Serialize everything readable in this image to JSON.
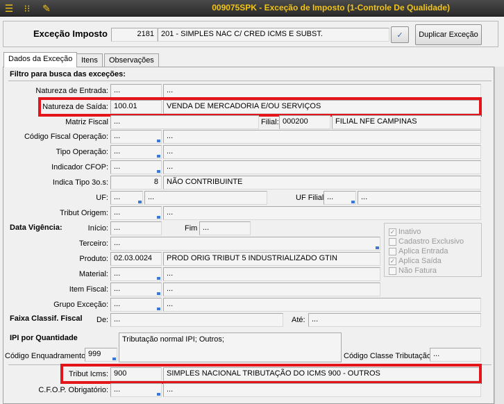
{
  "window": {
    "title": "009075SPK - Exceção de Imposto (1-Controle De Qualidade)",
    "icons": [
      "menu-icon",
      "traffic-light-icon",
      "wrench-icon"
    ]
  },
  "header": {
    "label": "Exceção Imposto",
    "code": "2181",
    "description": "201 - SIMPLES NAC C/ CRED ICMS E SUBST.",
    "confirm_icon": "✓",
    "duplicate_button": "Duplicar Exceção"
  },
  "tabs": [
    {
      "label": "Dados da Exceção",
      "active": true
    },
    {
      "label": "Itens",
      "active": false
    },
    {
      "label": "Observações",
      "active": false
    }
  ],
  "section_filter": "Filtro para busca das exceções:",
  "fields": {
    "natureza_entrada": {
      "label": "Natureza de Entrada:",
      "code": "...",
      "desc": "..."
    },
    "natureza_saida": {
      "label": "Natureza de Saída:",
      "code": "100.01",
      "desc": "VENDA DE MERCADORIA E/OU SERVIÇOS"
    },
    "matriz_fiscal": {
      "label": "Matriz Fiscal",
      "value": "..."
    },
    "filial": {
      "label": "Filial:",
      "code": "000200",
      "desc": "FILIAL NFE CAMPINAS"
    },
    "codigo_fiscal_operacao": {
      "label": "Código Fiscal Operação:",
      "code": "...",
      "desc": "..."
    },
    "tipo_operacao": {
      "label": "Tipo Operação:",
      "code": "...",
      "desc": "..."
    },
    "indicador_cfop": {
      "label": "Indicador CFOP:",
      "code": "...",
      "desc": "..."
    },
    "indica_tipo": {
      "label": "Indica Tipo 3o.s:",
      "code": "8",
      "desc": "NÃO CONTRIBUINTE"
    },
    "uf": {
      "label": "UF:",
      "code": "...",
      "desc": "..."
    },
    "uf_filial": {
      "label": "UF Filial",
      "code": "...",
      "desc": "..."
    },
    "tribut_origem": {
      "label": "Tribut Origem:",
      "code": "...",
      "desc": "..."
    },
    "data_vigencia": {
      "label": "Data Vigência:",
      "inicio_label": "Início:",
      "inicio": "...",
      "fim_label": "Fim",
      "fim": "..."
    },
    "terceiro": {
      "label": "Terceiro:",
      "value": "..."
    },
    "produto": {
      "label": "Produto:",
      "code": "02.03.0024",
      "desc": "PROD ORIG TRIBUT 5 INDUSTRIALIZADO GTIN"
    },
    "material": {
      "label": "Material:",
      "code": "...",
      "desc": "..."
    },
    "item_fiscal": {
      "label": "Item Fiscal:",
      "code": "...",
      "desc": "..."
    },
    "grupo_excecao": {
      "label": "Grupo Exceção:",
      "code": "...",
      "desc": "..."
    },
    "faixa_classif": {
      "label": "Faixa Classif. Fiscal",
      "de_label": "De:",
      "de": "...",
      "ate_label": "Até:",
      "ate": "..."
    },
    "ipi_quantidade": {
      "label": "IPI por Quantidade"
    },
    "codigo_enquadramento": {
      "label": "Código Enquadramento",
      "value": "999",
      "memo": "Tributação normal IPI; Outros;"
    },
    "codigo_classe_tributacao": {
      "label": "Código Classe Tributação",
      "value": "..."
    },
    "tribut_icms": {
      "label": "Tribut Icms:",
      "code": "900",
      "desc": "SIMPLES NACIONAL TRIBUTAÇÃO DO ICMS 900 - OUTROS"
    },
    "cfop_obrigatorio": {
      "label": "C.F.O.P. Obrigatório:",
      "code": "...",
      "desc": "..."
    }
  },
  "checkboxes": [
    {
      "label": "Inativo",
      "checked": true
    },
    {
      "label": "Cadastro Exclusivo",
      "checked": false
    },
    {
      "label": "Aplica Entrada",
      "checked": false
    },
    {
      "label": "Aplica Saída",
      "checked": true
    },
    {
      "label": "Não Fatura",
      "checked": false
    }
  ],
  "colors": {
    "title_text": "#f2c417",
    "highlight": "#e4141b",
    "lookup_corner": "#3a78d6"
  }
}
